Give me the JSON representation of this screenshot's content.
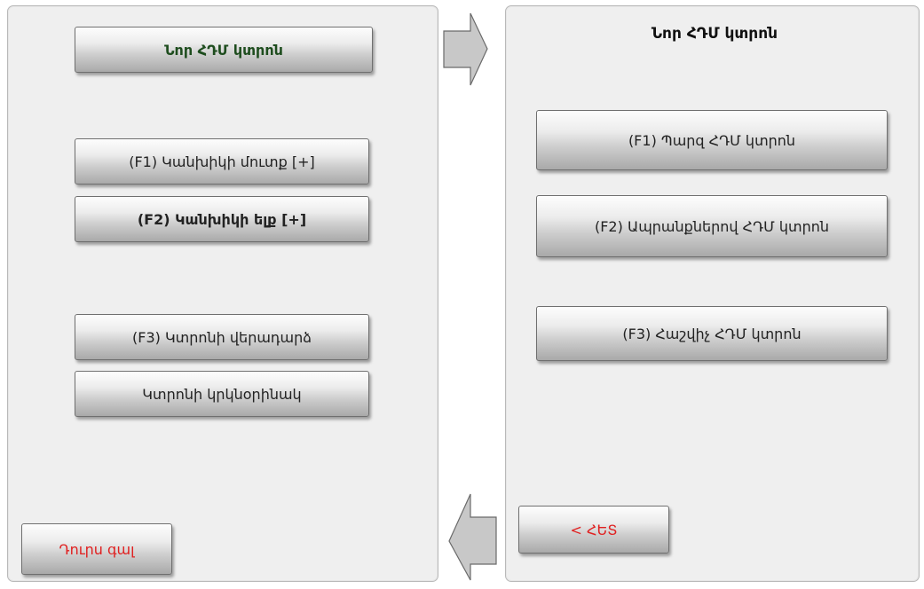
{
  "left_panel": {
    "title_button": "Նոր ՀԴՄ կտրոն",
    "buttons": [
      "(F1) Կանխիկի մուտք  [+]",
      "(F2) Կանխիկի ելք  [+]",
      "(F3) Կտրոնի վերադարձ",
      "Կտրոնի կրկնօրինակ"
    ],
    "exit_button": "Դուրս գալ"
  },
  "right_panel": {
    "heading": "Նոր ՀԴՄ կտրոն",
    "buttons": [
      "(F1) Պարզ ՀԴՄ կտրոն",
      "(F2) Ապրանքներով ՀԴՄ կտրոն",
      "(F3)  Հաշվիչ ՀԴՄ կտրոն"
    ],
    "back_button": "< ՀԵՏ"
  },
  "colors": {
    "title_text": "#1e4d1e",
    "red_text": "#e02020",
    "panel_bg": "#efefef",
    "arrow_fill": "#c8c8c8"
  }
}
